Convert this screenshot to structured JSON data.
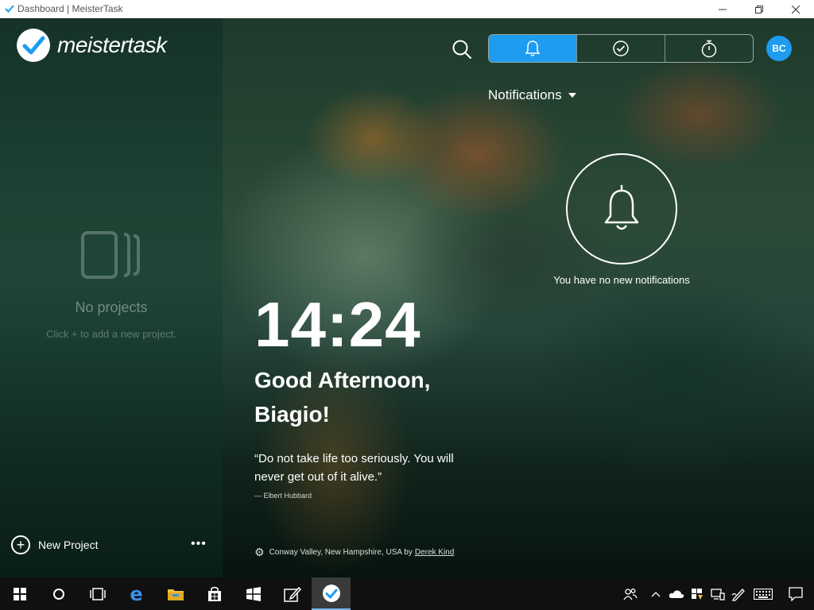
{
  "window": {
    "title": "Dashboard | MeisterTask",
    "icon": "meistertask-check-icon",
    "controls": [
      "minimize-icon",
      "maximize-icon",
      "close-icon"
    ]
  },
  "sidebar": {
    "logo_text": "meistertask",
    "empty_title": "No projects",
    "empty_hint": "Click + to add a new project.",
    "new_project_label": "New Project",
    "more_label": "•••"
  },
  "header": {
    "tabs": [
      {
        "icon": "bell-icon",
        "active": true
      },
      {
        "icon": "checkmark-circle-icon",
        "active": false
      },
      {
        "icon": "stopwatch-icon",
        "active": false
      }
    ],
    "avatar_initials": "BC",
    "accent_color": "#1e9cf0"
  },
  "notifications": {
    "title": "Notifications",
    "empty_text": "You have no new notifications"
  },
  "dashboard": {
    "time": "14:24",
    "greeting": "Good Afternoon, Biagio!",
    "quote": "“Do not take life too seriously. You will never get out of it alive.”",
    "quote_author": "— Elbert Hubbard",
    "photo_location": "Conway Valley, New Hampshire, USA by",
    "photo_author": "Derek Kind"
  },
  "taskbar": {
    "items": [
      "windows-start-icon",
      "cortana-icon",
      "task-view-icon",
      "edge-icon",
      "file-explorer-icon",
      "store-icon",
      "windows-app-icon",
      "pen-icon",
      "meistertask-icon"
    ],
    "tray": [
      "people-icon",
      "chevron-up-icon",
      "onedrive-icon",
      "security-icon",
      "network-icon",
      "pen-workspace-icon",
      "keyboard-icon",
      "action-center-icon"
    ]
  }
}
